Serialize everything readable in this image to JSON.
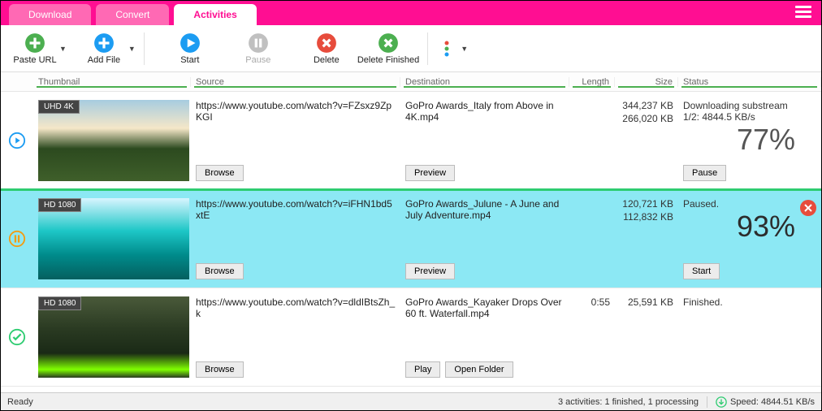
{
  "tabs": {
    "download": "Download",
    "convert": "Convert",
    "activities": "Activities"
  },
  "toolbar": {
    "paste_url": "Paste URL",
    "add_file": "Add File",
    "start": "Start",
    "pause": "Pause",
    "delete": "Delete",
    "delete_finished": "Delete Finished"
  },
  "columns": {
    "thumbnail": "Thumbnail",
    "source": "Source",
    "destination": "Destination",
    "length": "Length",
    "size": "Size",
    "status": "Status"
  },
  "rows": [
    {
      "badge": "UHD 4K",
      "source": "https://www.youtube.com/watch?v=FZsxz9ZpKGI",
      "dest": "GoPro Awards_Italy from Above in 4K.mp4",
      "length": "",
      "size1": "344,237 KB",
      "size2": "266,020 KB",
      "status": "Downloading substream 1/2: 4844.5 KB/s",
      "percent": "77%",
      "browse": "Browse",
      "preview": "Preview",
      "action": "Pause",
      "state": "playing"
    },
    {
      "badge": "HD 1080",
      "source": "https://www.youtube.com/watch?v=iFHN1bd5xtE",
      "dest": "GoPro Awards_Julune - A June and July Adventure.mp4",
      "length": "",
      "size1": "120,721 KB",
      "size2": "112,832 KB",
      "status": "Paused.",
      "percent": "93%",
      "browse": "Browse",
      "preview": "Preview",
      "action": "Start",
      "state": "paused"
    },
    {
      "badge": "HD 1080",
      "source": "https://www.youtube.com/watch?v=dldIBtsZh_k",
      "dest": "GoPro Awards_Kayaker Drops Over 60 ft. Waterfall.mp4",
      "length": "0:55",
      "size1": "25,591 KB",
      "size2": "",
      "status": "Finished.",
      "percent": "",
      "browse": "Browse",
      "play": "Play",
      "open_folder": "Open Folder",
      "state": "done"
    }
  ],
  "statusbar": {
    "ready": "Ready",
    "activities": "3 activities: 1 finished, 1 processing",
    "speed": "Speed: 4844.51 KB/s"
  }
}
